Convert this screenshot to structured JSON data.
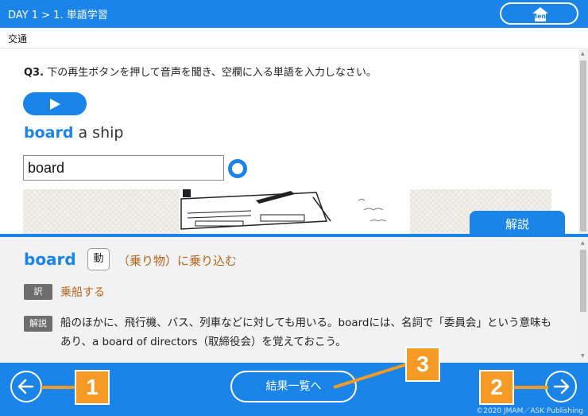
{
  "header": {
    "breadcrumb": "DAY 1 > 1. 単語学習",
    "menu_label": "Menu"
  },
  "category": "交通",
  "question": {
    "number": "Q3.",
    "instruction": "下の再生ボタンを押して音声を聞き、空欄に入る単語を入力しなさい。",
    "phrase_keyword": "board",
    "phrase_rest": " a ship",
    "answer_value": "board",
    "result": "correct"
  },
  "explanation_tab_label": "解説",
  "explanation": {
    "word": "board",
    "part_of_speech": "動",
    "meaning": "（乗り物）に乗り込む",
    "translation_tag": "訳",
    "translation": "乗船する",
    "note_tag": "解説",
    "note": "船のほかに、飛行機、バス、列車などに対しても用いる。boardには、名詞で「委員会」という意味もあり、a board of directors（取締役会）を覚えておこう。"
  },
  "footer": {
    "results_label": "結果一覧へ",
    "callouts": [
      "1",
      "2",
      "3"
    ],
    "copyright": "©2020 JMAM／ASK Publishing"
  },
  "icons": {
    "menu": "home-icon",
    "play": "play-icon",
    "prev": "arrow-left-icon",
    "next": "arrow-right-icon",
    "correct": "circle-correct-icon"
  },
  "colors": {
    "primary": "#1a84e8",
    "callout": "#f59b25",
    "meaning": "#b5651d",
    "panel": "#f2f2f2"
  }
}
